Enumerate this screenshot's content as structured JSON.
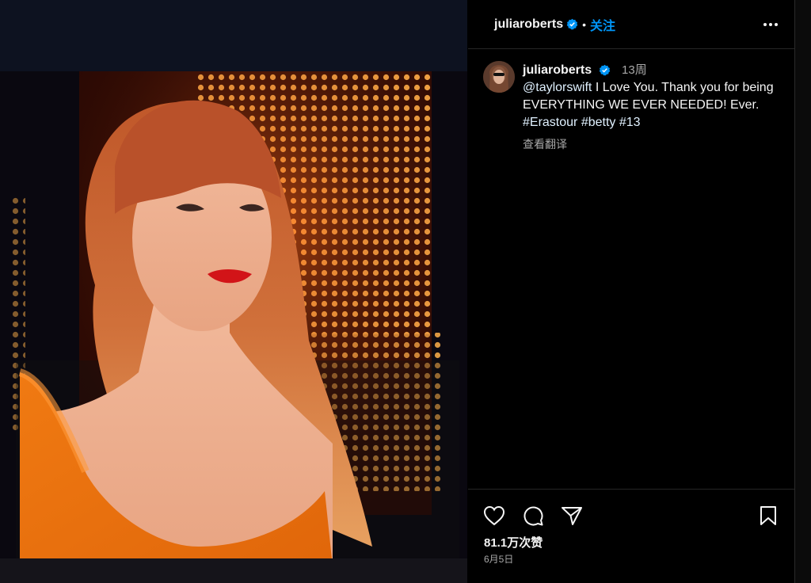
{
  "header": {
    "username": "juliaroberts",
    "separator": "•",
    "follow_label": "关注"
  },
  "caption": {
    "username": "juliaroberts",
    "time_ago": "13周",
    "mention": "@taylorswift",
    "text": " I Love You. Thank you for being EVERYTHING WE EVER NEEDED! Ever. ",
    "tags": [
      "#Erastour",
      "#betty",
      "#13"
    ],
    "translate_label": "查看翻译"
  },
  "stats": {
    "likes": "81.1万次赞",
    "date": "6月5日"
  },
  "icons": {
    "verified": "verified-badge-icon",
    "more": "more-options-icon",
    "like": "heart-icon",
    "comment": "comment-icon",
    "share": "paper-plane-icon",
    "save": "bookmark-icon"
  },
  "colors": {
    "follow": "#0095f6",
    "verified": "#0095f6",
    "background": "#000000",
    "muted": "#a8a8a8"
  }
}
